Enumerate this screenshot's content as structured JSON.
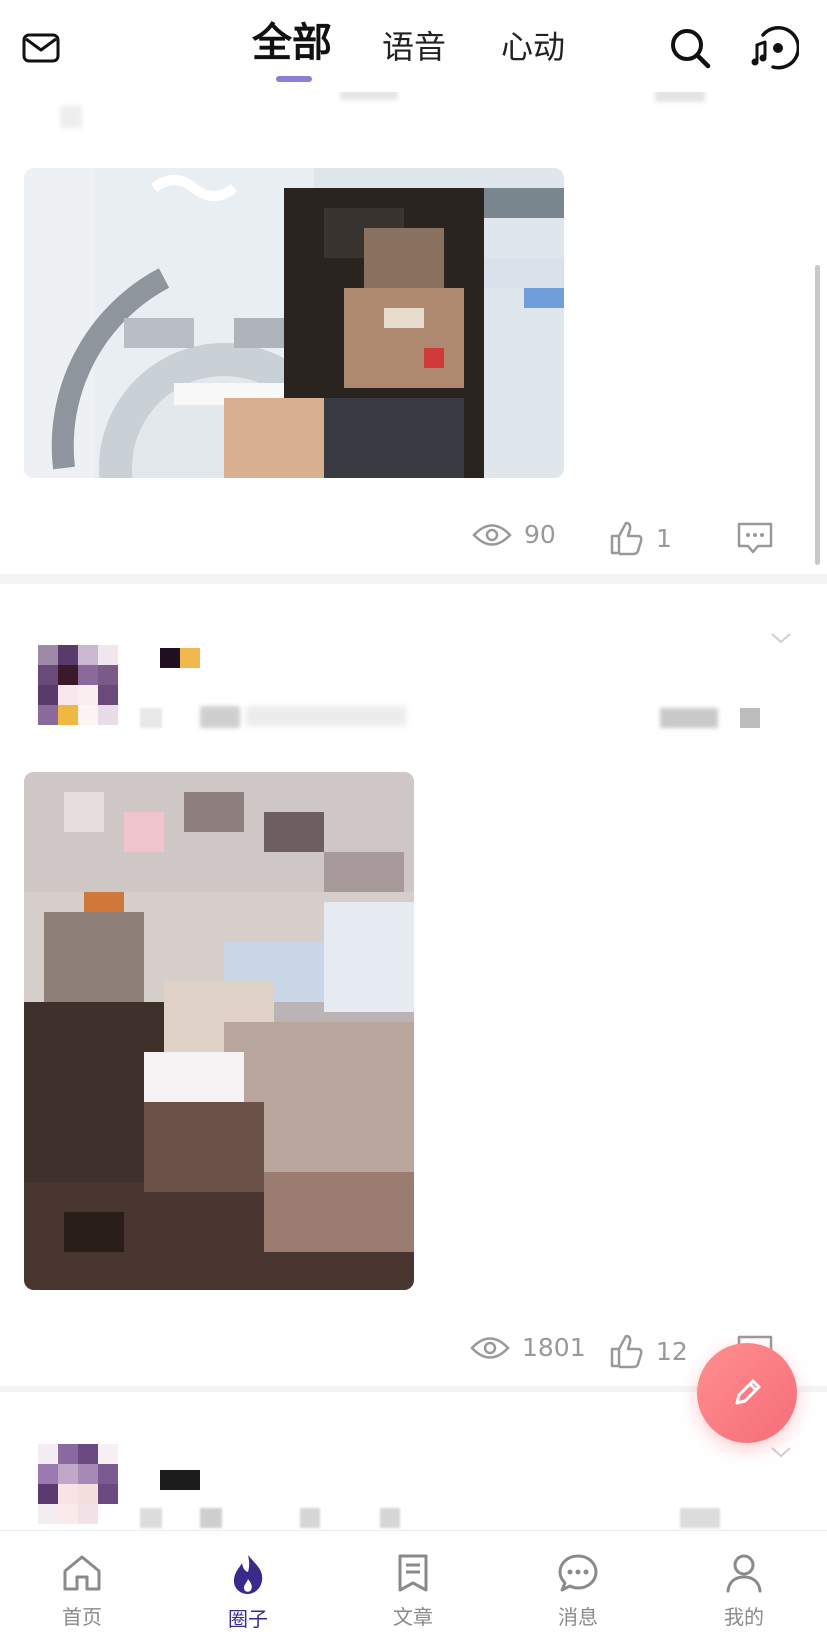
{
  "header": {
    "tabs": [
      {
        "label": "全部",
        "active": true
      },
      {
        "label": "语音",
        "active": false
      },
      {
        "label": "心动",
        "active": false
      }
    ],
    "icons": {
      "left": "mail-icon",
      "search": "search-icon",
      "right": "music-chat-icon"
    },
    "accent": "#8a80d8"
  },
  "posts": [
    {
      "views": "90",
      "likes": "1"
    },
    {
      "views": "1801",
      "likes": "12"
    }
  ],
  "fab": {
    "icon": "pencil-icon",
    "color": "#f56d79"
  },
  "bottom_nav": {
    "items": [
      {
        "label": "首页",
        "icon": "home-icon",
        "active": false
      },
      {
        "label": "圈子",
        "icon": "flame-icon",
        "active": true
      },
      {
        "label": "文章",
        "icon": "bookmark-icon",
        "active": false
      },
      {
        "label": "消息",
        "icon": "chat-bubble-icon",
        "active": false
      },
      {
        "label": "我的",
        "icon": "person-icon",
        "active": false
      }
    ],
    "active_color": "#3a2a8a"
  }
}
